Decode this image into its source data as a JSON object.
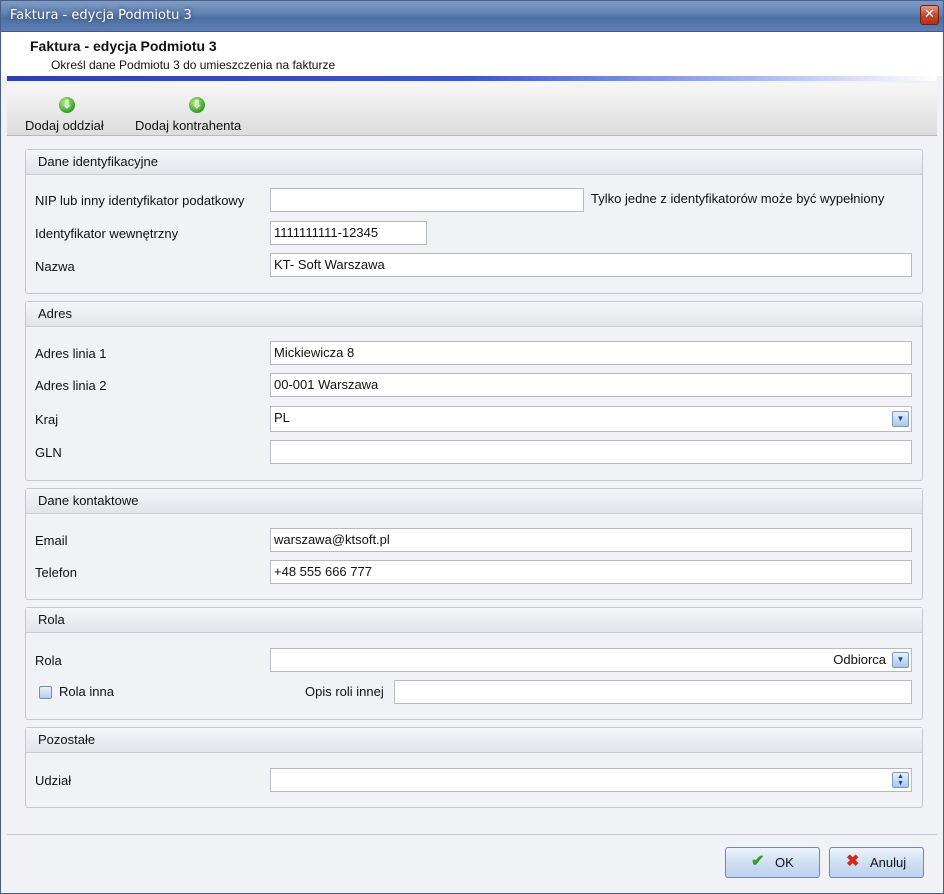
{
  "window": {
    "title": "Faktura - edycja Podmiotu 3",
    "close_glyph": "✕"
  },
  "header": {
    "title": "Faktura - edycja Podmiotu 3",
    "subtitle": "Określ dane Podmiotu 3 do umieszczenia na fakturze"
  },
  "toolbar": {
    "add_branch": {
      "label": "Dodaj oddział",
      "icon": "add-green-icon"
    },
    "add_contractor": {
      "label": "Dodaj kontrahenta",
      "icon": "add-green-icon"
    }
  },
  "ident": {
    "title": "Dane identyfikacyjne",
    "nip_label": "NIP lub inny identyfikator podatkowy",
    "nip_value": "",
    "nip_hint": "Tylko jedne z identyfikatorów może być wypełniony",
    "internal_label": "Identyfikator wewnętrzny",
    "internal_value": "1111111111-12345",
    "name_label": "Nazwa",
    "name_value": "KT- Soft Warszawa"
  },
  "address": {
    "title": "Adres",
    "line1_label": "Adres linia 1",
    "line1_value": "Mickiewicza 8",
    "line2_label": "Adres linia 2",
    "line2_value": "00-001 Warszawa",
    "country_label": "Kraj",
    "country_value": "PL",
    "gln_label": "GLN",
    "gln_value": ""
  },
  "contact": {
    "title": "Dane kontaktowe",
    "email_label": "Email",
    "email_value": "warszawa@ktsoft.pl",
    "phone_label": "Telefon",
    "phone_value": "+48 555 666 777"
  },
  "role": {
    "title": "Rola",
    "role_label": "Rola",
    "role_value": "Odbiorca",
    "other_checkbox_label": "Rola inna",
    "other_checked": false,
    "other_desc_label": "Opis roli innej",
    "other_desc_value": ""
  },
  "other": {
    "title": "Pozostałe",
    "share_label": "Udział",
    "share_value": ""
  },
  "buttons": {
    "ok_label": "OK",
    "cancel_label": "Anuluj",
    "ok_icon": "checkmark-icon",
    "cancel_icon": "red-x-icon"
  }
}
